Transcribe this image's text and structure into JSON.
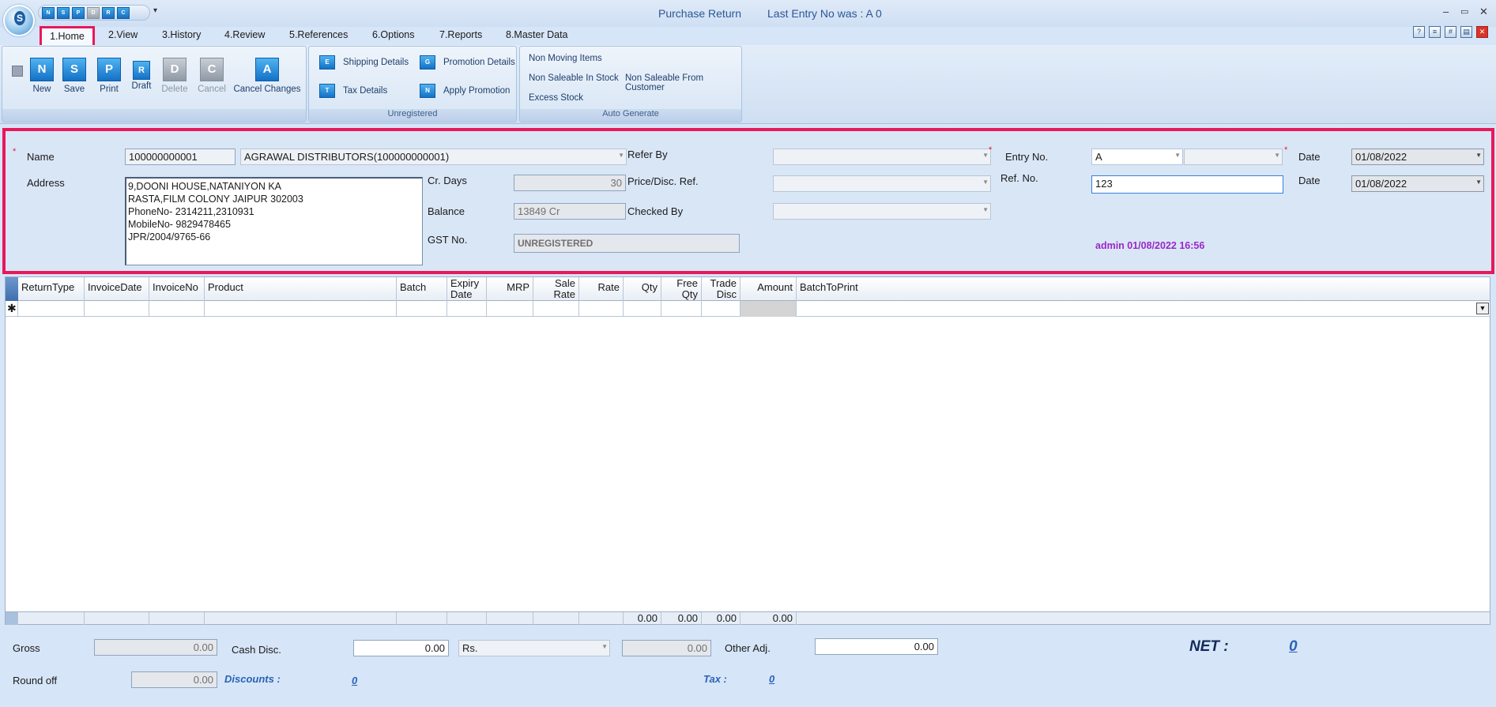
{
  "window": {
    "title": "Purchase Return",
    "last_entry": "Last Entry No was : A 0",
    "controls": [
      "–",
      "▭",
      "✕"
    ]
  },
  "quick_access": [
    "N",
    "S",
    "P",
    "D",
    "R",
    "C"
  ],
  "menu_tabs": [
    "1.Home",
    "2.View",
    "3.History",
    "4.Review",
    "5.References",
    "6.Options",
    "7.Reports",
    "8.Master Data"
  ],
  "ribbon": {
    "main_buttons": [
      {
        "label": "New",
        "glyph": "N",
        "enabled": true
      },
      {
        "label": "Save",
        "glyph": "S",
        "enabled": true
      },
      {
        "label": "Print",
        "glyph": "P",
        "enabled": true
      },
      {
        "label": "Draft",
        "glyph": "R",
        "enabled": true
      },
      {
        "label": "Delete",
        "glyph": "D",
        "enabled": false
      },
      {
        "label": "Cancel",
        "glyph": "C",
        "enabled": false
      },
      {
        "label": "Cancel Changes",
        "glyph": "A",
        "enabled": true
      }
    ],
    "details_buttons": [
      {
        "label": "Shipping Details",
        "glyph": "E"
      },
      {
        "label": "Promotion Details",
        "glyph": "G"
      },
      {
        "label": "Tax Details",
        "glyph": "T"
      },
      {
        "label": "Apply Promotion",
        "glyph": "N"
      }
    ],
    "details_group_label": "Unregistered",
    "auto_items": [
      "Non Moving Items",
      "Non Saleable In Stock",
      "Non Saleable From Customer",
      "Excess Stock"
    ],
    "auto_group_label": "Auto Generate"
  },
  "form": {
    "name_label": "Name",
    "name_code": "100000000001",
    "name_value": "AGRAWAL DISTRIBUTORS(100000000001)",
    "address_label": "Address",
    "address_lines": [
      "9,DOONI HOUSE,NATANIYON KA",
      "RASTA,FILM COLONY JAIPUR 302003",
      "PhoneNo- 2314211,2310931",
      "MobileNo- 9829478465",
      "JPR/2004/9765-66"
    ],
    "cr_days_label": "Cr. Days",
    "cr_days": "30",
    "balance_label": "Balance",
    "balance": "13849 Cr",
    "gst_label": "GST No.",
    "gst": "UNREGISTERED",
    "refer_by_label": "Refer By",
    "price_disc_label": "Price/Disc. Ref.",
    "checked_by_label": "Checked By",
    "entry_no_label": "Entry No.",
    "entry_series": "A",
    "entry_number": "",
    "date_label": "Date",
    "date1": "01/08/2022",
    "ref_no_label": "Ref. No.",
    "ref_no": "123",
    "date2": "01/08/2022",
    "audit": "admin 01/08/2022 16:56"
  },
  "grid": {
    "columns": [
      "ReturnType",
      "InvoiceDate",
      "InvoiceNo",
      "Product",
      "Batch",
      "Expiry Date",
      "MRP",
      "Sale Rate",
      "Rate",
      "Qty",
      "Free Qty",
      "Trade Disc",
      "Amount",
      "BatchToPrint"
    ],
    "totals": {
      "qty": "0.00",
      "free_qty": "0.00",
      "trade_disc": "0.00",
      "amount": "0.00"
    }
  },
  "totals": {
    "gross_label": "Gross",
    "gross": "0.00",
    "cash_disc_label": "Cash Disc.",
    "cash_disc": "0.00",
    "cash_disc_type": "Rs.",
    "cash_disc_amount": "0.00",
    "other_adj_label": "Other Adj.",
    "other_adj": "0.00",
    "net_label": "NET :",
    "net": "0",
    "round_off_label": "Round off",
    "round_off": "0.00",
    "discounts_label": "Discounts :",
    "discounts": "0",
    "tax_label": "Tax :",
    "tax": "0"
  }
}
